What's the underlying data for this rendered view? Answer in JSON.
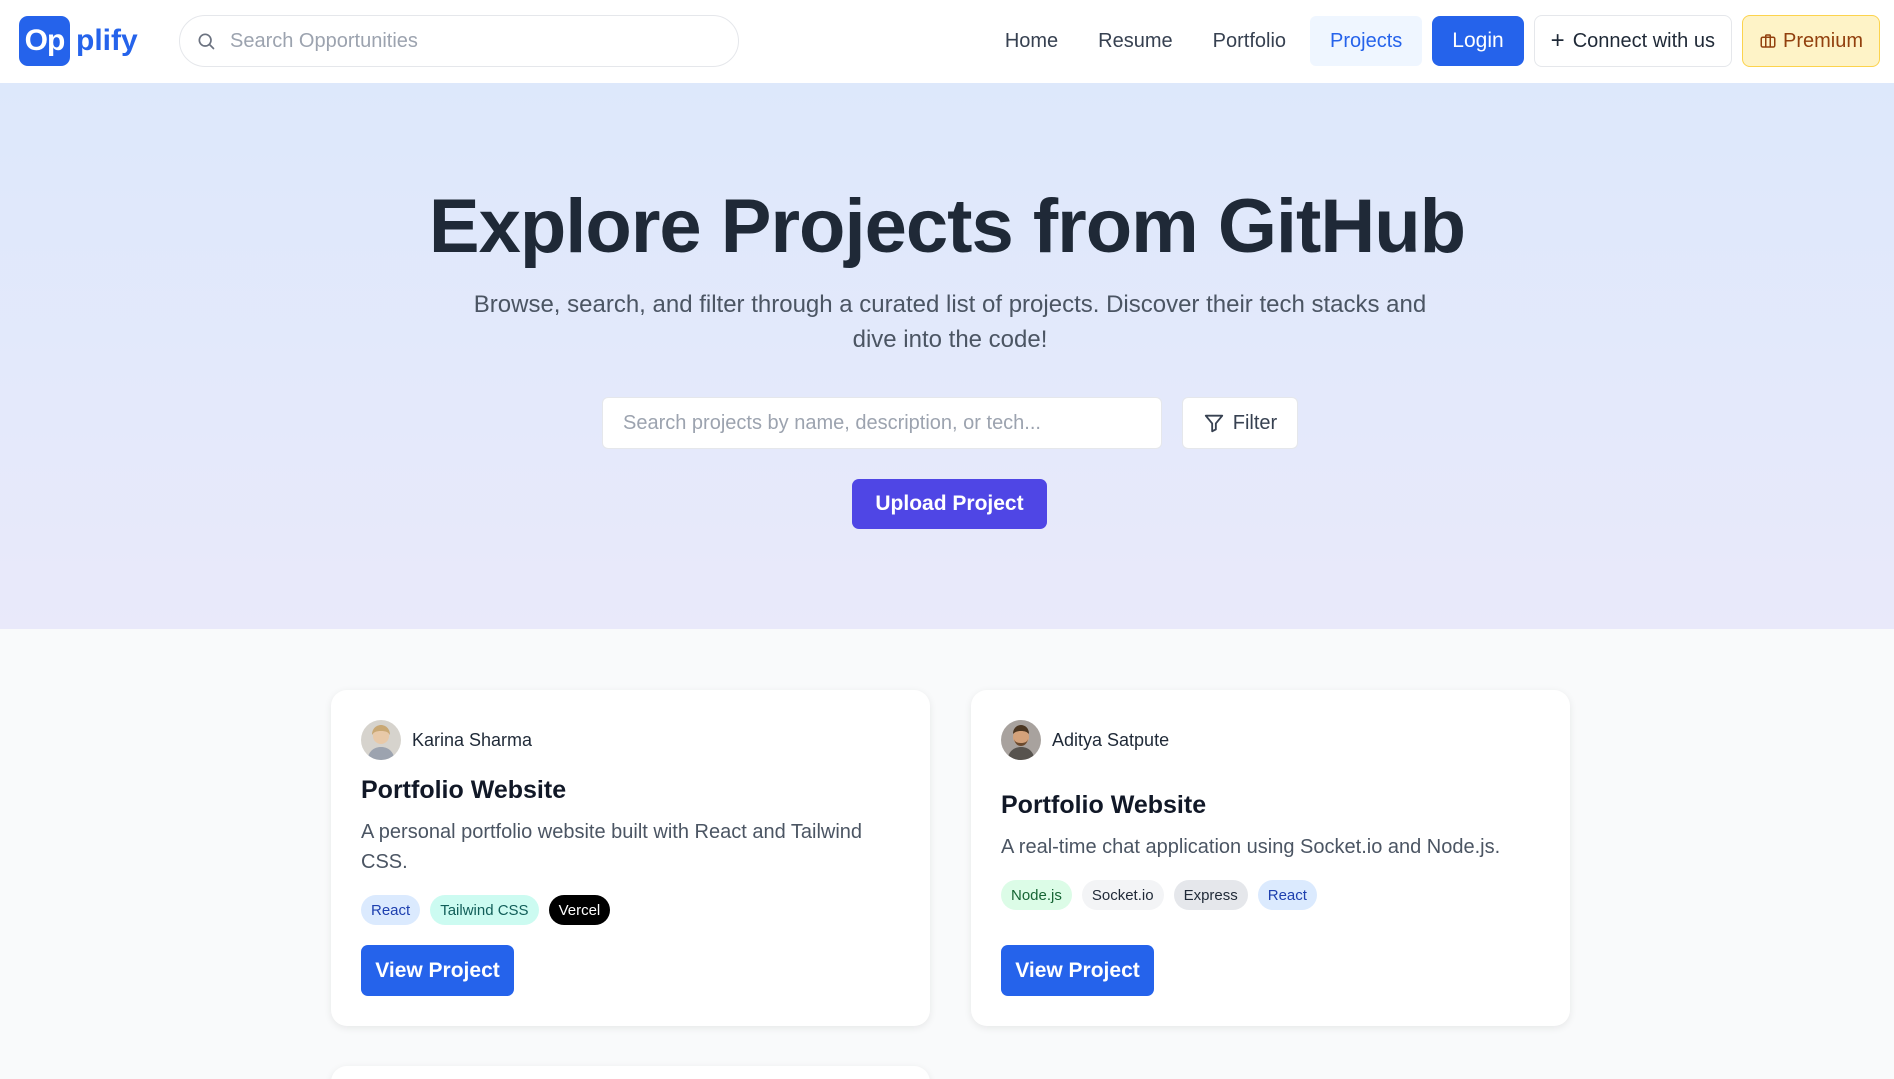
{
  "nav": {
    "logo_mark": "Op",
    "logo_text": "plify",
    "search_placeholder": "Search Opportunities",
    "links": [
      "Home",
      "Resume",
      "Portfolio",
      "Projects"
    ],
    "active_link": "Projects",
    "login_label": "Login",
    "connect_label": "Connect with us",
    "premium_label": "Premium"
  },
  "hero": {
    "title": "Explore Projects from GitHub",
    "subtitle": "Browse, search, and filter through a curated list of projects. Discover their tech stacks and dive into the code!",
    "search_placeholder": "Search projects by name, description, or tech...",
    "filter_label": "Filter",
    "upload_label": "Upload Project"
  },
  "projects": [
    {
      "author": "Karina Sharma",
      "title": "Portfolio Website",
      "description": "A personal portfolio website built with React and Tailwind CSS.",
      "tags": [
        {
          "label": "React",
          "bg": "#dbeafe",
          "color": "#1e40af"
        },
        {
          "label": "Tailwind CSS",
          "bg": "#ccfbf1",
          "color": "#115e59"
        },
        {
          "label": "Vercel",
          "bg": "#000000",
          "color": "#ffffff"
        }
      ],
      "button": "View Project"
    },
    {
      "author": "Aditya Satpute",
      "title": "Portfolio Website",
      "description": "A real-time chat application using Socket.io and Node.js.",
      "tags": [
        {
          "label": "Node.js",
          "bg": "#dcfce7",
          "color": "#166534"
        },
        {
          "label": "Socket.io",
          "bg": "#f3f4f6",
          "color": "#1f2937"
        },
        {
          "label": "Express",
          "bg": "#e5e7eb",
          "color": "#1f2937"
        },
        {
          "label": "React",
          "bg": "#dbeafe",
          "color": "#1e40af"
        }
      ],
      "button": "View Project"
    }
  ],
  "colors": {
    "primary": "#2563eb",
    "upload": "#4f46e5",
    "premium_bg": "#fef3c7"
  }
}
